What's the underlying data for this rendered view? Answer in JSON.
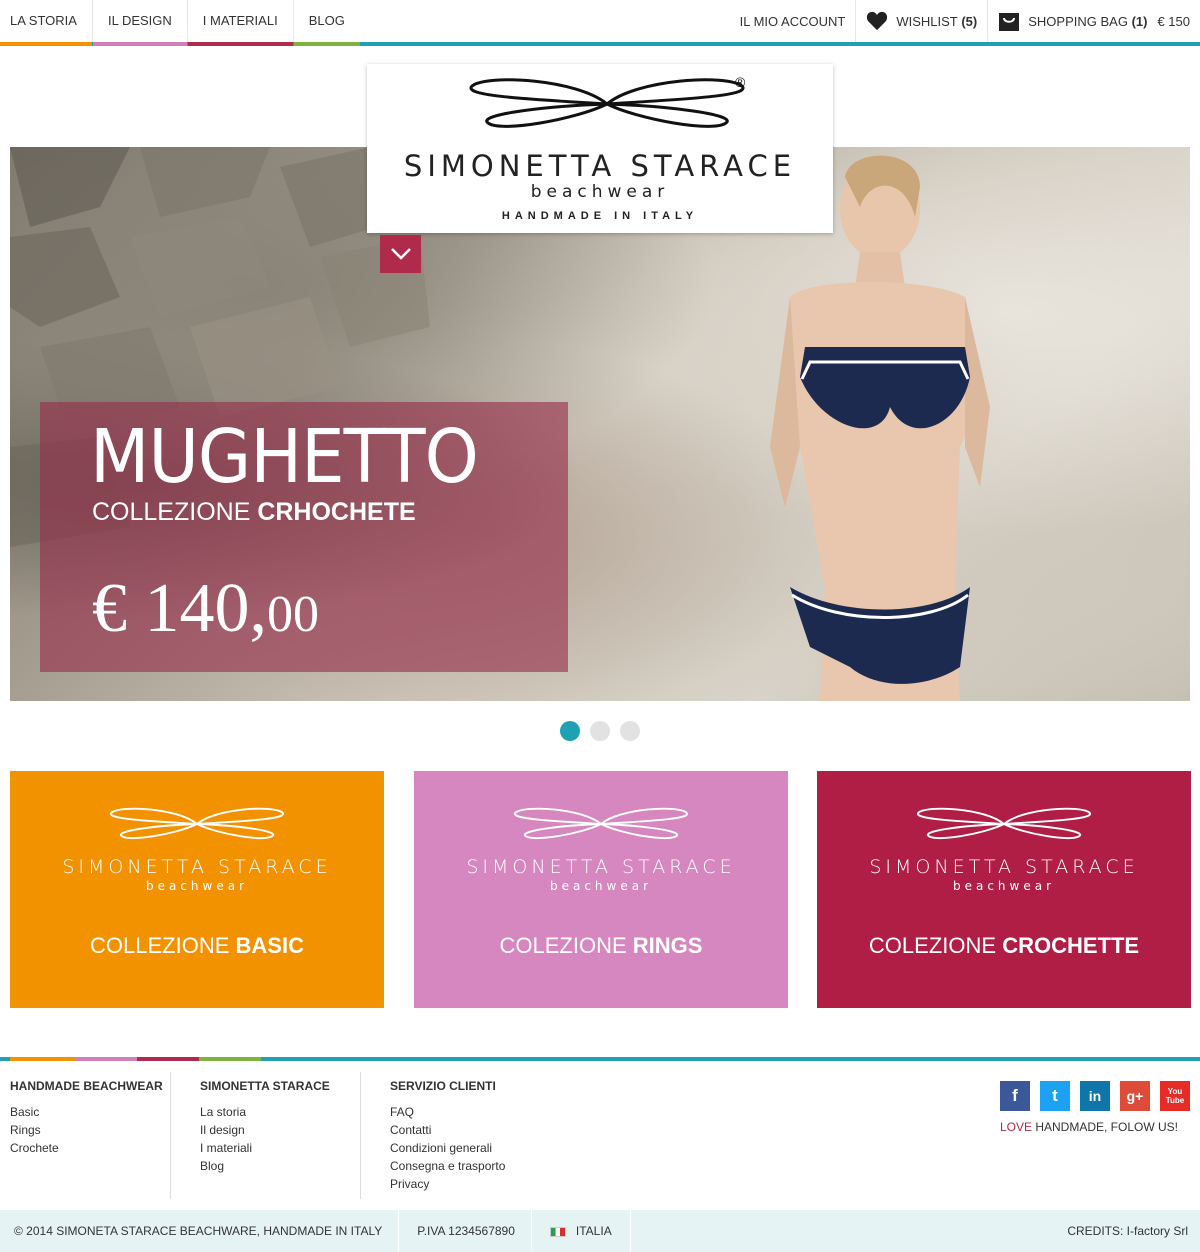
{
  "nav": {
    "items": [
      {
        "label": "LA STORIA",
        "accent": "#f39200"
      },
      {
        "label": "IL DESIGN",
        "accent": "#d07fbd"
      },
      {
        "label": "I MATERIALI",
        "accent": "#b02a4c"
      },
      {
        "label": "BLOG",
        "accent": "#7eb33d"
      }
    ],
    "account": "IL MIO ACCOUNT",
    "wishlist_label": "WISHLIST",
    "wishlist_count": "(5)",
    "bag_label": "SHOPPING BAG",
    "bag_count": "(1)",
    "bag_price": "€ 150"
  },
  "logo": {
    "name": "SIMONETTA STARACE",
    "sub": "beachwear",
    "tagline": "HANDMADE IN ITALY",
    "registered": "®"
  },
  "hero": {
    "title": "MUGHETTO",
    "collection_prefix": "COLLEZIONE",
    "collection_name": "CRHOCHETE",
    "price_main": "€ 140,",
    "price_cents": "00",
    "slides": 3,
    "active_slide": 1
  },
  "collections": [
    {
      "prefix": "COLLEZIONE",
      "name": "BASIC",
      "color": "#f39200"
    },
    {
      "prefix": "COLEZIONE",
      "name": "RINGS",
      "color": "#d687bf"
    },
    {
      "prefix": "COLEZIONE",
      "name": "CROCHETTE",
      "color": "#b01e45"
    }
  ],
  "footer": {
    "col1": {
      "title": "HANDMADE BEACHWEAR",
      "links": [
        "Basic",
        "Rings",
        "Crochete"
      ]
    },
    "col2": {
      "title": "SIMONETTA STARACE",
      "links": [
        "La storia",
        "Il design",
        "I materiali",
        "Blog"
      ]
    },
    "col3": {
      "title": "SERVIZIO CLIENTI",
      "links": [
        "FAQ",
        "Contatti",
        "Condizioni generali",
        "Consegna e trasporto",
        "Privacy"
      ]
    },
    "social": [
      {
        "name": "facebook-icon",
        "glyph": "f",
        "color": "#3b5998"
      },
      {
        "name": "twitter-icon",
        "glyph": "t",
        "color": "#1da1f2"
      },
      {
        "name": "linkedin-icon",
        "glyph": "in",
        "color": "#0e76a8"
      },
      {
        "name": "google-plus-icon",
        "glyph": "g+",
        "color": "#dd4b39"
      },
      {
        "name": "youtube-icon",
        "glyph": "You Tube",
        "color": "#e52d27"
      }
    ],
    "love_word": "LOVE",
    "love_rest": " HANDMADE, FOLOW US!",
    "copyright": "© 2014 SIMONETA STARACE BEACHWARE, HANDMADE IN ITALY",
    "piva": "P.IVA 1234567890",
    "country": "ITALIA",
    "credits": "CREDITS: I-factory Srl"
  },
  "colors": {
    "accent": "#1fa0b3",
    "brand_red": "#b02a4c"
  }
}
